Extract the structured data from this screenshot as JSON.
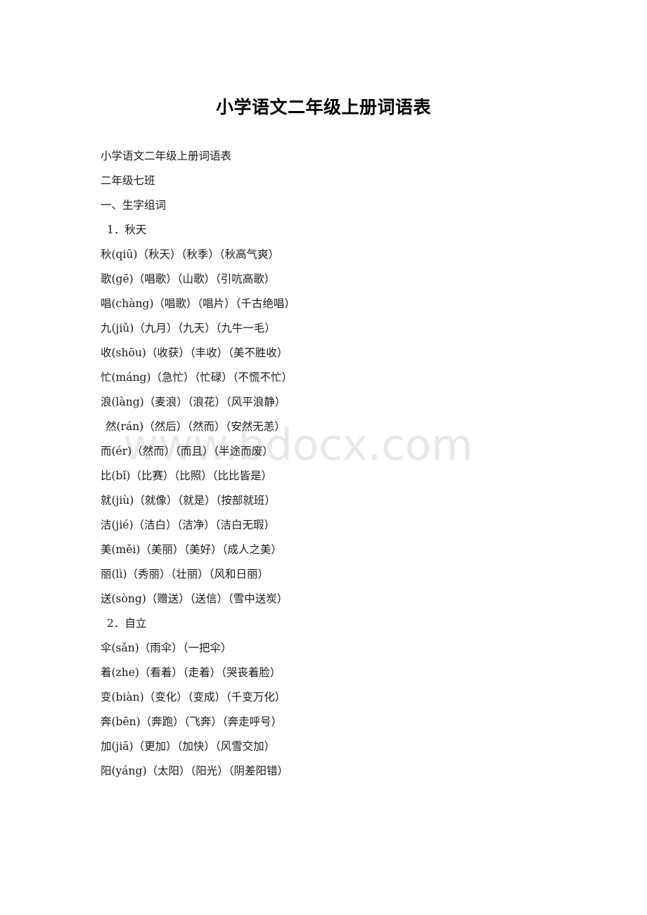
{
  "document": {
    "title": "小学语文二年级上册词语表",
    "watermark": "www.bdocx.com"
  },
  "body": {
    "lines": [
      {
        "text": "小学语文二年级上册词语表",
        "style": "normal"
      },
      {
        "text": "二年级七班",
        "style": "normal"
      },
      {
        "text": "一、生字组词",
        "style": "normal"
      },
      {
        "text": "1．秋天",
        "style": "indent-sm"
      },
      {
        "text": "秋(qiū)（秋天）（秋季）（秋高气爽）",
        "style": "normal"
      },
      {
        "text": "歌(gē)（唱歌）（山歌）（引吭高歌）",
        "style": "normal"
      },
      {
        "text": "唱(chàng)（唱歌）（唱片）（千古绝唱）",
        "style": "normal"
      },
      {
        "text": "九(jiǔ)（九月）（九天）（九牛一毛）",
        "style": "normal"
      },
      {
        "text": "收(shōu)（收获）（丰收）（美不胜收）",
        "style": "normal"
      },
      {
        "text": "忙(máng)（急忙）（忙碌）（不慌不忙）",
        "style": "normal"
      },
      {
        "text": "浪(làng)（麦浪）（浪花）（风平浪静）",
        "style": "normal"
      },
      {
        "text": "然(rán)（然后）（然而）（安然无恙）",
        "style": "indent-xs"
      },
      {
        "text": "而(ér)（然而）（而且）（半途而废）",
        "style": "normal"
      },
      {
        "text": "比(bǐ)（比赛）（比照）（比比皆是）",
        "style": "normal"
      },
      {
        "text": "就(jiù)（就像）（就是）（按部就班）",
        "style": "normal"
      },
      {
        "text": "洁(jié)（洁白）（洁净）（洁白无瑕）",
        "style": "normal"
      },
      {
        "text": "美(měi)（美丽）（美好）（成人之美）",
        "style": "normal"
      },
      {
        "text": "丽(lì)（秀丽）（壮丽）（风和日丽）",
        "style": "normal"
      },
      {
        "text": "送(sòng)（赠送）（送信）（雪中送炭）",
        "style": "normal"
      },
      {
        "text": "2．自立",
        "style": "indent-sm"
      },
      {
        "text": "伞(sǎn)（雨伞）（一把伞）",
        "style": "normal"
      },
      {
        "text": "着(zhe)（看着）（走着）（哭丧着脸）",
        "style": "normal"
      },
      {
        "text": "变(biàn)（变化）（变成）（千变万化）",
        "style": "normal"
      },
      {
        "text": "奔(bēn)（奔跑）（飞奔）（奔走呼号）",
        "style": "normal"
      },
      {
        "text": "加(jiā)（更加）（加快）（风雪交加）",
        "style": "normal"
      },
      {
        "text": "阳(yáng)（太阳）（阳光）（阴差阳错）",
        "style": "normal"
      }
    ]
  }
}
